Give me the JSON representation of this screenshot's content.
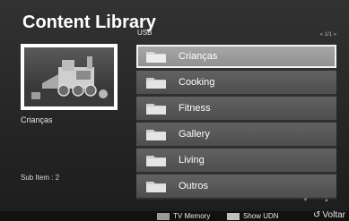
{
  "title": "Content Library",
  "preview": {
    "selected_name": "Crianças",
    "sub_item_text": "Sub Item : 2"
  },
  "list": {
    "source_label": "USB",
    "pager": "« 1/1 »",
    "items": [
      {
        "label": "Crianças",
        "selected": true,
        "icon": "folder-icon"
      },
      {
        "label": "Cooking",
        "selected": false,
        "icon": "folder-icon"
      },
      {
        "label": "Fitness",
        "selected": false,
        "icon": "folder-icon"
      },
      {
        "label": "Gallery",
        "selected": false,
        "icon": "folder-icon"
      },
      {
        "label": "Living",
        "selected": false,
        "icon": "folder-icon"
      },
      {
        "label": "Outros",
        "selected": false,
        "icon": "folder-icon"
      }
    ],
    "scroll_arrows": "▼ ▲"
  },
  "footer": {
    "tv_memory": {
      "label": "TV Memory",
      "color": "#9a9a9a"
    },
    "show_udn": {
      "label": "Show UDN",
      "color": "#bfbfbf"
    },
    "back": {
      "label": "Voltar",
      "icon": "return-arrow-icon"
    }
  },
  "colors": {
    "background": "#2a2a2a",
    "row": "#585858",
    "row_selected": "#9c9c9c",
    "folder": "#d9d9d9"
  }
}
